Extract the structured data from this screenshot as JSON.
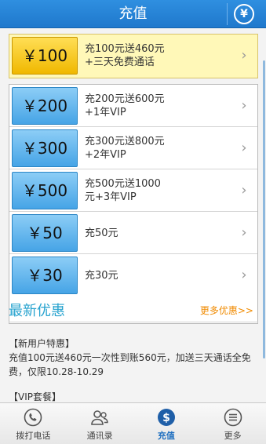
{
  "header": {
    "title": "充值",
    "yen_icon": "yen-circle-icon"
  },
  "featured": {
    "amount": "￥100",
    "line1": "充100元送460元",
    "line2": "+三天免费通话"
  },
  "options": [
    {
      "amount": "￥200",
      "line1": "充200元送600元",
      "line2": "+1年VIP"
    },
    {
      "amount": "￥300",
      "line1": "充300元送800元",
      "line2": "+2年VIP"
    },
    {
      "amount": "￥500",
      "line1": "充500元送1000",
      "line2": "元+3年VIP"
    },
    {
      "amount": "￥50",
      "line1": "充50元",
      "line2": ""
    },
    {
      "amount": "￥30",
      "line1": "充30元",
      "line2": ""
    }
  ],
  "promo": {
    "title": "最新优惠",
    "more": "更多优惠>>",
    "new_user_head": "【新用户特惠】",
    "new_user_body": "充值100元送460元一次性到账560元，加送三天通话全免费，仅限10.28-10.29",
    "vip_head": "【VIP套餐】"
  },
  "tabs": [
    {
      "label": "拨打电话",
      "icon": "phone-icon"
    },
    {
      "label": "通讯录",
      "icon": "contacts-icon"
    },
    {
      "label": "充值",
      "icon": "dollar-icon"
    },
    {
      "label": "更多",
      "icon": "more-icon"
    }
  ],
  "colors": {
    "accent": "#1f78cc",
    "promo_title": "#27a3cf",
    "more_link": "#f08a00"
  }
}
